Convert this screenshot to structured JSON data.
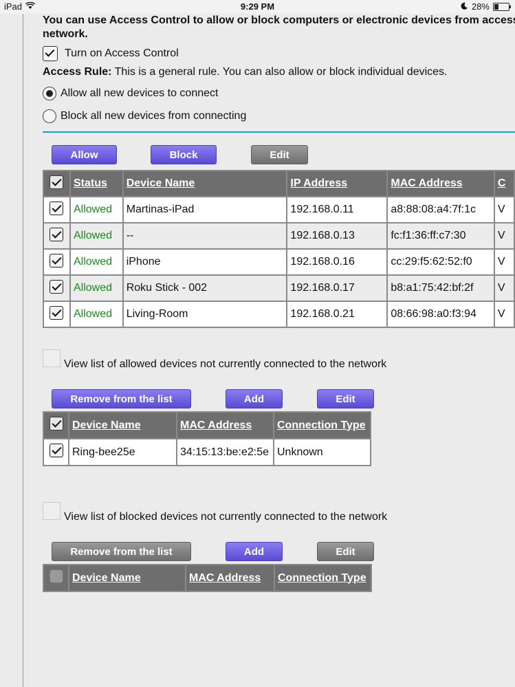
{
  "status_bar": {
    "device": "iPad",
    "time": "9:29 PM",
    "battery": "28%",
    "battery_level": 0.28
  },
  "heading": "You can use Access Control to allow or block computers or electronic devices from access network.",
  "turn_on_label": "Turn on Access Control",
  "access_rule": {
    "label": "Access Rule:",
    "text": " This is a general rule. You can also allow or block individual devices."
  },
  "radio_allow": "Allow all new devices to connect",
  "radio_block": "Block all new devices from connecting",
  "buttons_top": {
    "allow": "Allow",
    "block": "Block",
    "edit": "Edit"
  },
  "devices_table": {
    "headers": [
      "Status",
      "Device Name",
      "IP Address",
      "MAC Address",
      "C"
    ],
    "rows": [
      {
        "status": "Allowed",
        "name": "Martinas-iPad",
        "ip": "192.168.0.11",
        "mac": "a8:88:08:a4:7f:1c",
        "extra": "V"
      },
      {
        "status": "Allowed",
        "name": "--",
        "ip": "192.168.0.13",
        "mac": "fc:f1:36:ff:c7:30",
        "extra": "V"
      },
      {
        "status": "Allowed",
        "name": "iPhone",
        "ip": "192.168.0.16",
        "mac": "cc:29:f5:62:52:f0",
        "extra": "V"
      },
      {
        "status": "Allowed",
        "name": "Roku Stick - 002",
        "ip": "192.168.0.17",
        "mac": "b8:a1:75:42:bf:2f",
        "extra": "V"
      },
      {
        "status": "Allowed",
        "name": "Living-Room",
        "ip": "192.168.0.21",
        "mac": "08:66:98:a0:f3:94",
        "extra": "V"
      }
    ]
  },
  "allowed_offline": {
    "checkbox_label": "View list of allowed devices not currently connected to the network",
    "buttons": {
      "remove": "Remove from the list",
      "add": "Add",
      "edit": "Edit"
    },
    "headers": [
      "Device Name",
      "MAC Address",
      "Connection Type"
    ],
    "rows": [
      {
        "name": "Ring-bee25e",
        "mac": "34:15:13:be:e2:5e",
        "type": "Unknown"
      }
    ]
  },
  "blocked_offline": {
    "checkbox_label": "View list of blocked devices not currently connected to the network",
    "buttons": {
      "remove": "Remove from the list",
      "add": "Add",
      "edit": "Edit"
    },
    "headers": [
      "Device Name",
      "MAC Address",
      "Connection Type"
    ]
  },
  "colors": {
    "accent_purple": "#6b5ce6",
    "allowed_green": "#1a8a1a",
    "divider_blue": "#1a9bd6",
    "header_gray": "#6e6e6e"
  }
}
